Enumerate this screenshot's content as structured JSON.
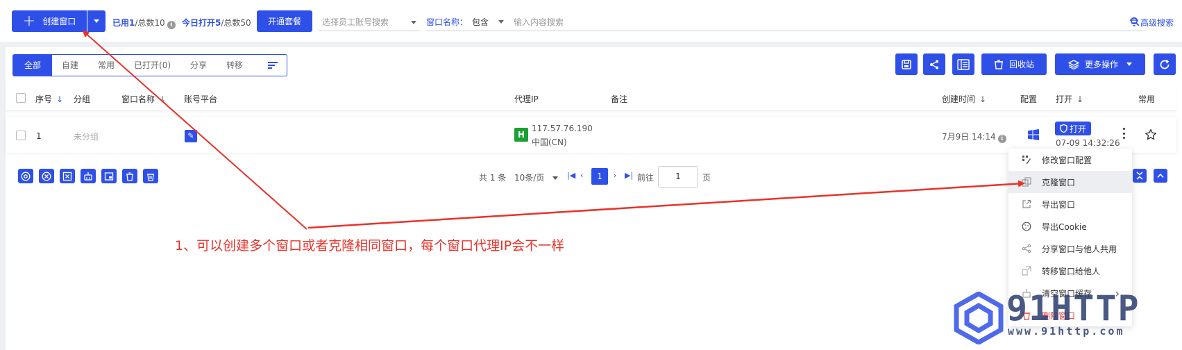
{
  "toolbar": {
    "create_label": "创建窗口",
    "used_label": "已用",
    "used_count": "1",
    "total_label": "/总数10",
    "today_label": "今日打开",
    "today_count": "5",
    "today_total": "/总数50",
    "open_package": "开通套餐",
    "employee_placeholder": "选择员工账号搜索",
    "window_name_label": "窗口名称：",
    "match_op": "包含",
    "keyword_placeholder": "输入内容搜索",
    "advanced_search": "高级搜索"
  },
  "tabs": [
    "全部",
    "自建",
    "常用",
    "已打开(0)",
    "分享",
    "转移"
  ],
  "actions": {
    "recycle_bin": "回收站",
    "more_actions": "更多操作"
  },
  "table": {
    "headers": {
      "index": "序号",
      "group": "分组",
      "window_name": "窗口名称",
      "platform": "账号平台",
      "proxy_ip": "代理IP",
      "note": "备注",
      "created": "创建时间",
      "config": "配置",
      "open": "打开",
      "favorite": "常用"
    },
    "rows": [
      {
        "index": "1",
        "group": "未分组",
        "proxy_badge": "H",
        "proxy_ip": "117.57.76.190",
        "proxy_region": "中国(CN)",
        "created": "7月9日 14:14",
        "open_label": "打开",
        "opened_at": "07-09 14:32:26"
      }
    ]
  },
  "pagination": {
    "total": "共 1 条",
    "page_size": "10条/页",
    "current": "1",
    "goto_label": "前往",
    "goto_value": "1",
    "page_unit": "页"
  },
  "context_menu": [
    {
      "label": "修改窗口配置",
      "icon": "grid-edit-icon"
    },
    {
      "label": "克隆窗口",
      "icon": "clone-icon"
    },
    {
      "label": "导出窗口",
      "icon": "export-icon"
    },
    {
      "label": "导出Cookie",
      "icon": "cookie-icon"
    },
    {
      "label": "分享窗口与他人共用",
      "icon": "share-icon"
    },
    {
      "label": "转移窗口给他人",
      "icon": "transfer-icon"
    },
    {
      "label": "清空窗口缓存",
      "icon": "clear-cache-icon"
    },
    {
      "label": "删除窗口",
      "icon": "delete-icon"
    }
  ],
  "annotation": "1、可以创建多个窗口或者克隆相同窗口，每个窗口代理IP会不一样",
  "watermark": {
    "brand": "91HTTP",
    "url": "www.91http.com"
  },
  "colors": {
    "primary": "#2f50e8",
    "annotation": "#e8332a",
    "proxy_badge": "#1aa032"
  }
}
